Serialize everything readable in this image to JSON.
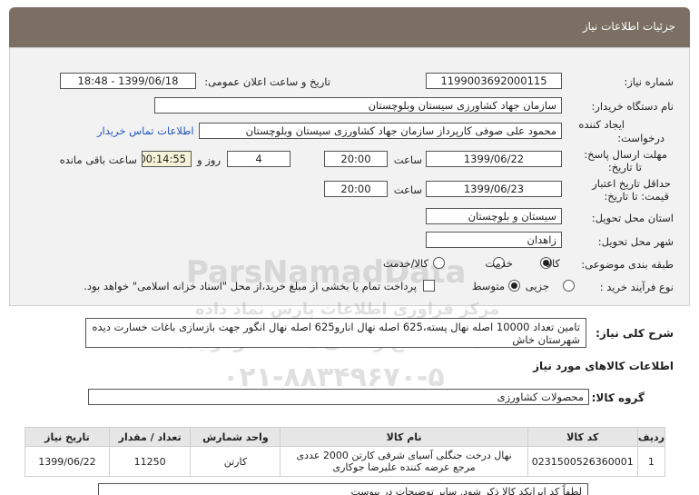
{
  "header": {
    "title": "جزئیات اطلاعات نیاز"
  },
  "form": {
    "need_number_label": "شماره نیاز:",
    "need_number": "1199003692000115",
    "announce_label": "تاریخ و ساعت اعلان عمومی:",
    "announce_value": "1399/06/18 - 18:48",
    "buyer_label": "نام دستگاه خریدار:",
    "buyer_value": "سازمان جهاد کشاورزی سیستان وبلوچستان",
    "creator_label_1": "ایجاد کننده",
    "creator_label_2": "درخواست:",
    "creator_value": "محمود علی صوفی کارپرداز سازمان جهاد کشاورزی سیستان وبلوچستان",
    "contact_link": "اطلاعات تماس خریدار",
    "reply_label_1": "مهلت ارسال پاسخ:",
    "reply_label_2": "تا تاریخ:",
    "reply_date": "1399/06/22",
    "time_label": "ساعت",
    "reply_time": "20:00",
    "days_value": "4",
    "days_label": "روز و",
    "remaining_value": "00:14:55",
    "remaining_label": "ساعت باقی مانده",
    "validity_label_1": "حداقل تاریخ اعتبار",
    "validity_label_2": "قیمت: تا تاریخ:",
    "validity_date": "1399/06/23",
    "validity_time": "20:00",
    "province_label": "استان محل تحویل:",
    "province_value": "سیستان و بلوچستان",
    "city_label": "شهر محل تحویل:",
    "city_value": "زاهدان",
    "category_label": "طبقه بندی موضوعی:",
    "category_options": [
      "کالا",
      "خدمت",
      "کالا/خدمت"
    ],
    "category_selected": "کالا",
    "process_label": "نوع فرآیند خرید :",
    "process_options": [
      "جزیی",
      "متوسط"
    ],
    "process_selected": "متوسط",
    "payment_note": "پرداخت تمام یا بخشی از مبلغ خرید،از محل \"اسناد خزانه اسلامی\" خواهد بود."
  },
  "description": {
    "label": "شرح کلی نیاز:",
    "text": "تامین تعداد 10000 اصله نهال پسته،625 اصله نهال انارو625 اصله نهال انگور جهت بازسازی باغات خسارت دیده شهرستان خاش"
  },
  "goods": {
    "section_title": "اطلاعات کالاهای مورد نیاز",
    "group_label": "گروه کالا:",
    "group_value": "محصولات کشاورزی",
    "columns": [
      "ردیف",
      "کد کالا",
      "نام کالا",
      "واحد شمارش",
      "تعداد / مقدار",
      "تاریخ نیاز"
    ],
    "rows": [
      {
        "index": "1",
        "code": "0231500526360001",
        "name": "نهال درخت جنگلی آسیای شرقی کارتن 2000 عددی مرجع عرضه کننده علیرضا جوکاری",
        "unit": "کارتن",
        "qty": "11250",
        "date": "1399/06/22"
      }
    ]
  },
  "watermark": {
    "brand": "ParsNamadData",
    "line1": "مرکز فراوری اطلاعات پارس نماد داده",
    "line2": "سامانه اطلاع رسانی مناقصه ومزایده",
    "phone": "۰۲۱-۸۸۳۴۹۶۷۰-۵"
  },
  "bottom_note": "لطفاً کد ایرانکد کالا ذکر شود. سایر توضیحات در پیوست"
}
